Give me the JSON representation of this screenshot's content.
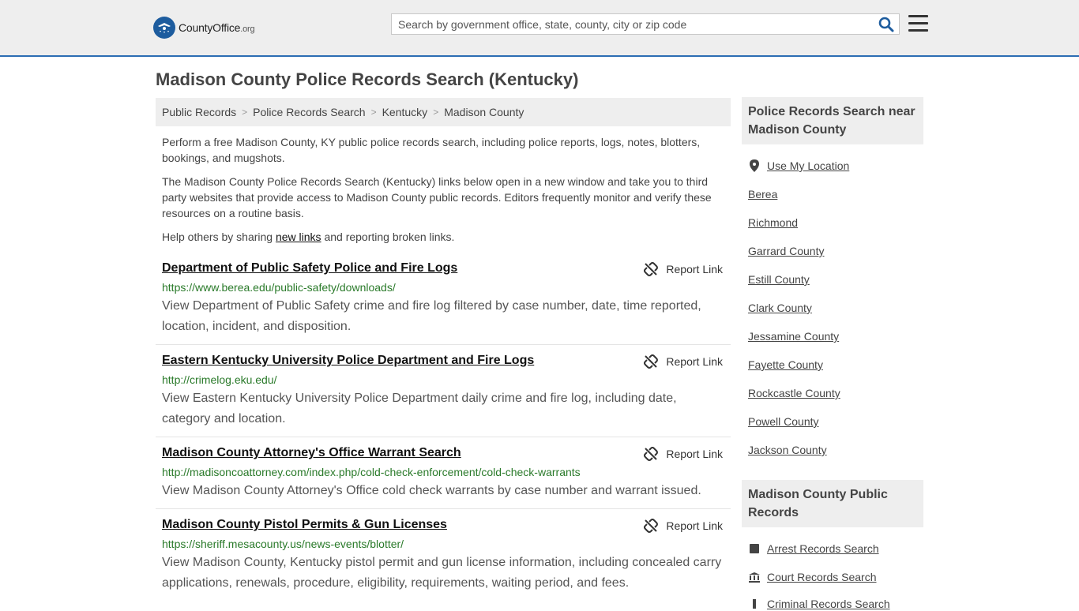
{
  "header": {
    "logo_main": "CountyOffice",
    "logo_suffix": ".org",
    "search_placeholder": "Search by government office, state, county, city or zip code"
  },
  "page": {
    "title": "Madison County Police Records Search (Kentucky)"
  },
  "breadcrumb": [
    "Public Records",
    "Police Records Search",
    "Kentucky",
    "Madison County"
  ],
  "intro": {
    "p1": "Perform a free Madison County, KY public police records search, including police reports, logs, notes, blotters, bookings, and mugshots.",
    "p2": "The Madison County Police Records Search (Kentucky) links below open in a new window and take you to third party websites that provide access to Madison County public records. Editors frequently monitor and verify these resources on a routine basis.",
    "p3_before": "Help others by sharing ",
    "p3_link": "new links",
    "p3_after": " and reporting broken links."
  },
  "report_label": "Report Link",
  "results": [
    {
      "title": "Department of Public Safety Police and Fire Logs",
      "url": "https://www.berea.edu/public-safety/downloads/",
      "description": "View Department of Public Safety crime and fire log filtered by case number, date, time reported, location, incident, and disposition."
    },
    {
      "title": "Eastern Kentucky University Police Department and Fire Logs",
      "url": "http://crimelog.eku.edu/",
      "description": "View Eastern Kentucky University Police Department daily crime and fire log, including date, category and location."
    },
    {
      "title": "Madison County Attorney's Office Warrant Search",
      "url": "http://madisoncoattorney.com/index.php/cold-check-enforcement/cold-check-warrants",
      "description": "View Madison County Attorney's Office cold check warrants by case number and warrant issued."
    },
    {
      "title": "Madison County Pistol Permits & Gun Licenses",
      "url": "https://sheriff.mesacounty.us/news-events/blotter/",
      "description": "View Madison County, Kentucky pistol permit and gun license information, including concealed carry applications, renewals, procedure, eligibility, requirements, waiting period, and fees."
    }
  ],
  "sidebar": {
    "nearby_heading": "Police Records Search near Madison County",
    "use_location": "Use My Location",
    "nearby": [
      "Berea",
      "Richmond",
      "Garrard County",
      "Estill County",
      "Clark County",
      "Jessamine County",
      "Fayette County",
      "Rockcastle County",
      "Powell County",
      "Jackson County"
    ],
    "public_heading": "Madison County Public Records",
    "public_links": [
      "Arrest Records Search",
      "Court Records Search",
      "Criminal Records Search"
    ]
  },
  "colors": {
    "accent": "#2c6db3",
    "url_green": "#2a7a2a",
    "panel_gray": "#eeeeee"
  }
}
